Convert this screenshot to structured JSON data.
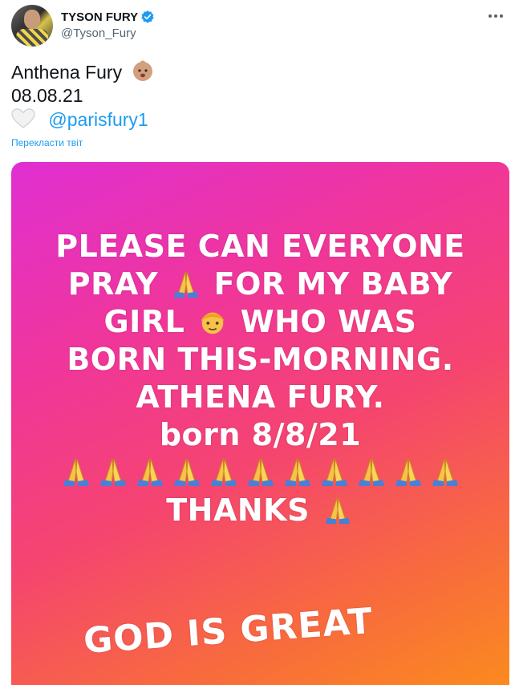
{
  "tweet": {
    "display_name": "TYSON FURY",
    "handle": "@Tyson_Fury",
    "text_line1": "Anthena Fury",
    "text_line2": "08.08.21",
    "mention": "@parisfury1",
    "translate_label": "Перекласти твіт"
  },
  "icons": {
    "verified": "verified-badge-icon",
    "more": "more-options-icon",
    "baby_emoji": "baby-emoji",
    "heart_emoji": "white-heart-emoji",
    "pray_emoji": "folded-hands-emoji",
    "girl_emoji": "girl-emoji"
  },
  "colors": {
    "accent": "#1d9bf0",
    "media_gradient_start": "#e02fd2",
    "media_gradient_end": "#fb8a1f"
  },
  "media": {
    "line1": "PLEASE CAN EVERYONE",
    "line2_a": "PRAY",
    "line2_b": "FOR MY BABY",
    "line3_a": "GIRL",
    "line3_b": "WHO WAS",
    "line4": "BORN THIS-MORNING.",
    "line5": "ATHENA FURY.",
    "line6": "born 8/8/21",
    "pray_row_count": 11,
    "line8": "THANKS",
    "footer": "GOD IS GREAT"
  }
}
